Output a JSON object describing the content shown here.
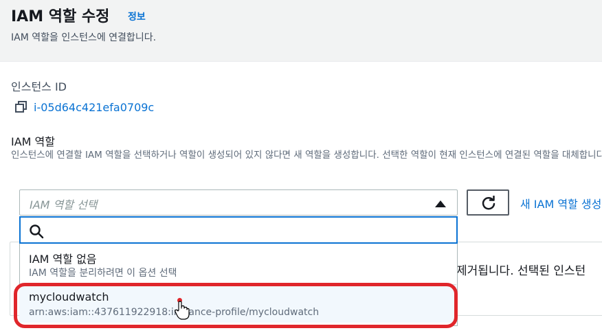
{
  "header": {
    "title": "IAM 역할 수정",
    "info_link": "정보",
    "subtitle": "IAM 역할을 인스턴스에 연결합니다."
  },
  "instance": {
    "label": "인스턴스 ID",
    "id": "i-05d64c421efa0709c"
  },
  "iam_role": {
    "label": "IAM 역할",
    "description": "인스턴스에 연결할 IAM 역할을 선택하거나 역할이 생성되어 있지 않다면 새 역할을 생성합니다. 선택한 역할이 현재 인스턴스에 연결된 역할을 대체합니다.",
    "select_placeholder": "IAM 역할 선택",
    "search_value": "",
    "new_role_link": "새 IAM 역할 생성"
  },
  "dropdown": {
    "options": [
      {
        "label": "IAM 역할 없음",
        "sublabel": "IAM 역할을 분리하려면 이 옵션 선택"
      },
      {
        "label": "mycloudwatch",
        "sublabel": "arn:aws:iam::437611922918:instance-profile/mycloudwatch"
      }
    ]
  },
  "underlying_text": "제거됩니다. 선택된 인스턴",
  "colors": {
    "link": "#0972d3",
    "focus": "#0972d3",
    "highlight_annotation": "#e0262b"
  },
  "icons": [
    "copy-icon",
    "caret-up-icon",
    "refresh-icon",
    "search-icon",
    "hand-cursor-icon"
  ]
}
